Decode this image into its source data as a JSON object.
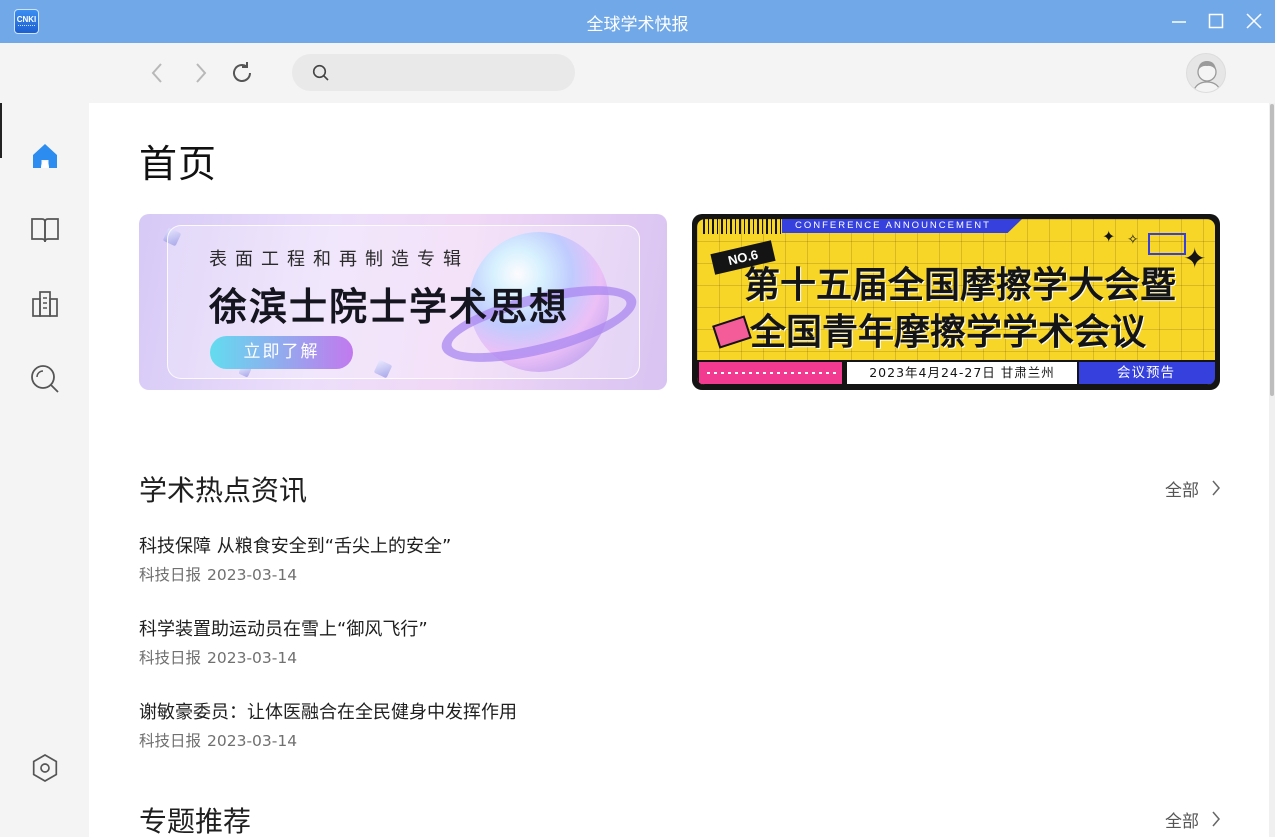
{
  "window": {
    "title": "全球学术快报",
    "logo_text": "CNKI",
    "title_bar_color": "#70a8e8"
  },
  "toolbar": {
    "search_value": "",
    "search_placeholder": ""
  },
  "sidebar": {
    "items": [
      {
        "name": "home",
        "icon": "home-icon",
        "active": true
      },
      {
        "name": "library",
        "icon": "book-icon",
        "active": false
      },
      {
        "name": "institution",
        "icon": "building-icon",
        "active": false
      },
      {
        "name": "search",
        "icon": "search-icon",
        "active": false
      },
      {
        "name": "settings",
        "icon": "settings-hexagon-icon",
        "active": false
      }
    ],
    "active_color": "#2d8cf0"
  },
  "main": {
    "page_title": "首页",
    "banners": [
      {
        "subtitle": "表面工程和再制造专辑",
        "title": "徐滨士院士学术思想",
        "button": "立即了解"
      },
      {
        "tag": "CONFERENCE ANNOUNCEMENT",
        "number": "NO.6",
        "line1": "第十五届全国摩擦学大会暨",
        "line2": "全国青年摩擦学学术会议",
        "date_place": "2023年4月24-27日  甘肃兰州",
        "label": "会议预告"
      }
    ],
    "hot_news": {
      "title": "学术热点资讯",
      "more_label": "全部",
      "items": [
        {
          "title": "科技保障 从粮食安全到“舌尖上的安全”",
          "source": "科技日报",
          "date": "2023-03-14"
        },
        {
          "title": "科学装置助运动员在雪上“御风飞行”",
          "source": "科技日报",
          "date": "2023-03-14"
        },
        {
          "title": "谢敏豪委员：让体医融合在全民健身中发挥作用",
          "source": "科技日报",
          "date": "2023-03-14"
        }
      ]
    },
    "topics": {
      "title": "专题推荐",
      "more_label": "全部"
    }
  }
}
